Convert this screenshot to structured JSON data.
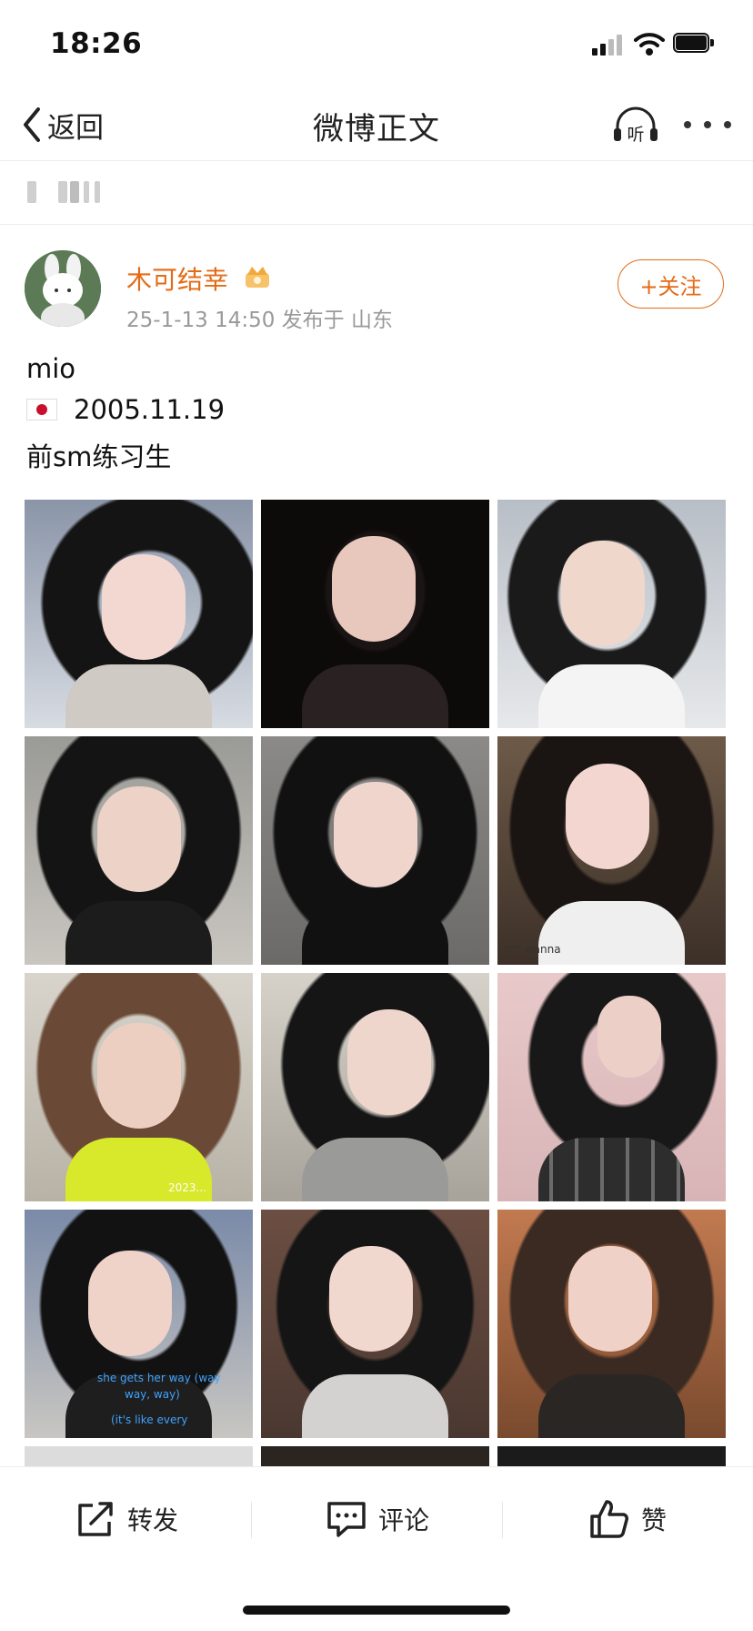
{
  "status_bar": {
    "time": "18:26",
    "icons": [
      "cellular-signal-icon",
      "wifi-icon",
      "battery-icon"
    ]
  },
  "navbar": {
    "back_label": "返回",
    "title": "微博正文",
    "listen_icon_label": "听",
    "icons": [
      "chevron-left-icon",
      "headphones-listen-icon",
      "more-icon"
    ]
  },
  "post": {
    "username": "木可结幸",
    "meta": "25-1-13 14:50  发布于 山东",
    "follow_label": "+关注",
    "text_line1": "mio",
    "text_line2": "2005.11.19",
    "text_line3": "前sm练习生",
    "flag_icon": "japan-flag-icon",
    "accent_color": "#e46b16",
    "photo_count_visible": 15
  },
  "photo_captions": {
    "p6": "*** wanna",
    "p7": "2023...",
    "p10a": "she gets her way (way",
    "p10b": "way, way)",
    "p10c": "(it's like every"
  },
  "actions": {
    "repost_label": "转发",
    "comment_label": "评论",
    "like_label": "赞"
  }
}
